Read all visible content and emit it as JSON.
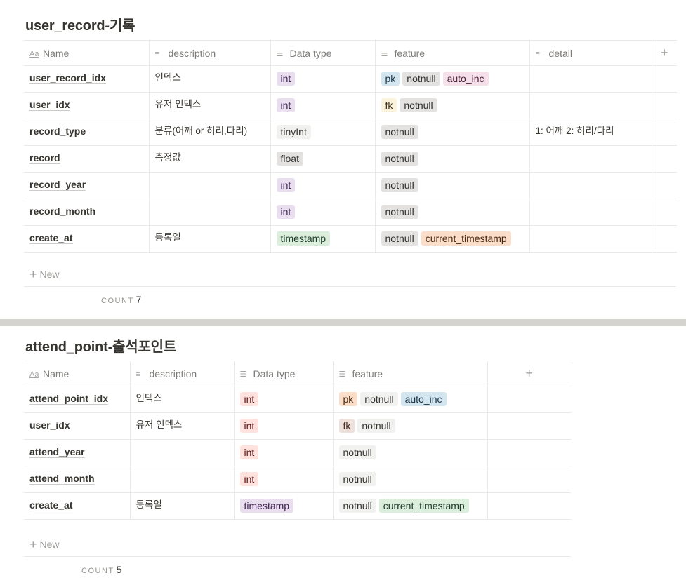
{
  "colors": {
    "default": {
      "bg": "#f1f1ef",
      "fg": "#37352f"
    },
    "gray": {
      "bg": "#e3e2e0",
      "fg": "#32302c"
    },
    "purple": {
      "bg": "#e8deee",
      "fg": "#412454"
    },
    "blue": {
      "bg": "#d3e5ef",
      "fg": "#183347"
    },
    "pink": {
      "bg": "#f5e0e9",
      "fg": "#4c2337"
    },
    "yellow": {
      "bg": "#fbf3db",
      "fg": "#402c1b"
    },
    "orange": {
      "bg": "#fadec9",
      "fg": "#49290e"
    },
    "green": {
      "bg": "#dbeddb",
      "fg": "#1c3829"
    },
    "red": {
      "bg": "#ffe2dd",
      "fg": "#5d1715"
    },
    "brown": {
      "bg": "#eee0da",
      "fg": "#442a1e"
    }
  },
  "tables": [
    {
      "title": "user_record-기록",
      "columns": [
        {
          "label": "Name",
          "icon": "title-icon"
        },
        {
          "label": "description",
          "icon": "text-icon"
        },
        {
          "label": "Data type",
          "icon": "multi-select-icon"
        },
        {
          "label": "feature",
          "icon": "multi-select-icon"
        },
        {
          "label": "detail",
          "icon": "text-icon"
        }
      ],
      "add_column": "+",
      "rows": [
        {
          "name": "user_record_idx",
          "description": "인덱스",
          "type": [
            {
              "t": "int",
              "c": "purple"
            }
          ],
          "feature": [
            {
              "t": "pk",
              "c": "blue"
            },
            {
              "t": "notnull",
              "c": "gray"
            },
            {
              "t": "auto_inc",
              "c": "pink"
            }
          ],
          "detail": ""
        },
        {
          "name": "user_idx",
          "description": "유저 인덱스",
          "type": [
            {
              "t": "int",
              "c": "purple"
            }
          ],
          "feature": [
            {
              "t": "fk",
              "c": "yellow"
            },
            {
              "t": "notnull",
              "c": "gray"
            }
          ],
          "detail": ""
        },
        {
          "name": "record_type",
          "description": "분류(어깨 or 허리,다리)",
          "type": [
            {
              "t": "tinyInt",
              "c": "default"
            }
          ],
          "feature": [
            {
              "t": "notnull",
              "c": "gray"
            }
          ],
          "detail": "1: 어깨 2: 허리/다리"
        },
        {
          "name": "record",
          "description": "측정값",
          "type": [
            {
              "t": "float",
              "c": "gray"
            }
          ],
          "feature": [
            {
              "t": "notnull",
              "c": "gray"
            }
          ],
          "detail": ""
        },
        {
          "name": "record_year",
          "description": "",
          "type": [
            {
              "t": "int",
              "c": "purple"
            }
          ],
          "feature": [
            {
              "t": "notnull",
              "c": "gray"
            }
          ],
          "detail": ""
        },
        {
          "name": "record_month",
          "description": "",
          "type": [
            {
              "t": "int",
              "c": "purple"
            }
          ],
          "feature": [
            {
              "t": "notnull",
              "c": "gray"
            }
          ],
          "detail": ""
        },
        {
          "name": "create_at",
          "description": "등록일",
          "type": [
            {
              "t": "timestamp",
              "c": "green"
            }
          ],
          "feature": [
            {
              "t": "notnull",
              "c": "gray"
            },
            {
              "t": "current_timestamp",
              "c": "orange"
            }
          ],
          "detail": ""
        }
      ],
      "new_label": "New",
      "count_label": "COUNT",
      "count_value": "7"
    },
    {
      "title": "attend_point-출석포인트",
      "columns": [
        {
          "label": "Name",
          "icon": "title-icon"
        },
        {
          "label": "description",
          "icon": "text-icon"
        },
        {
          "label": "Data type",
          "icon": "multi-select-icon"
        },
        {
          "label": "feature",
          "icon": "multi-select-icon"
        }
      ],
      "add_column": "+",
      "rows": [
        {
          "name": "attend_point_idx",
          "description": "인덱스",
          "type": [
            {
              "t": "int",
              "c": "red"
            }
          ],
          "feature": [
            {
              "t": "pk",
              "c": "orange"
            },
            {
              "t": "notnull",
              "c": "default"
            },
            {
              "t": "auto_inc",
              "c": "blue"
            }
          ]
        },
        {
          "name": "user_idx",
          "description": "유저 인덱스",
          "type": [
            {
              "t": "int",
              "c": "red"
            }
          ],
          "feature": [
            {
              "t": "fk",
              "c": "brown"
            },
            {
              "t": "notnull",
              "c": "default"
            }
          ]
        },
        {
          "name": "attend_year",
          "description": "",
          "type": [
            {
              "t": "int",
              "c": "red"
            }
          ],
          "feature": [
            {
              "t": "notnull",
              "c": "default"
            }
          ]
        },
        {
          "name": "attend_month",
          "description": "",
          "type": [
            {
              "t": "int",
              "c": "red"
            }
          ],
          "feature": [
            {
              "t": "notnull",
              "c": "default"
            }
          ]
        },
        {
          "name": "create_at",
          "description": "등록일",
          "type": [
            {
              "t": "timestamp",
              "c": "purple"
            }
          ],
          "feature": [
            {
              "t": "notnull",
              "c": "default"
            },
            {
              "t": "current_timestamp",
              "c": "green"
            }
          ]
        }
      ],
      "new_label": "New",
      "count_label": "COUNT",
      "count_value": "5"
    }
  ]
}
